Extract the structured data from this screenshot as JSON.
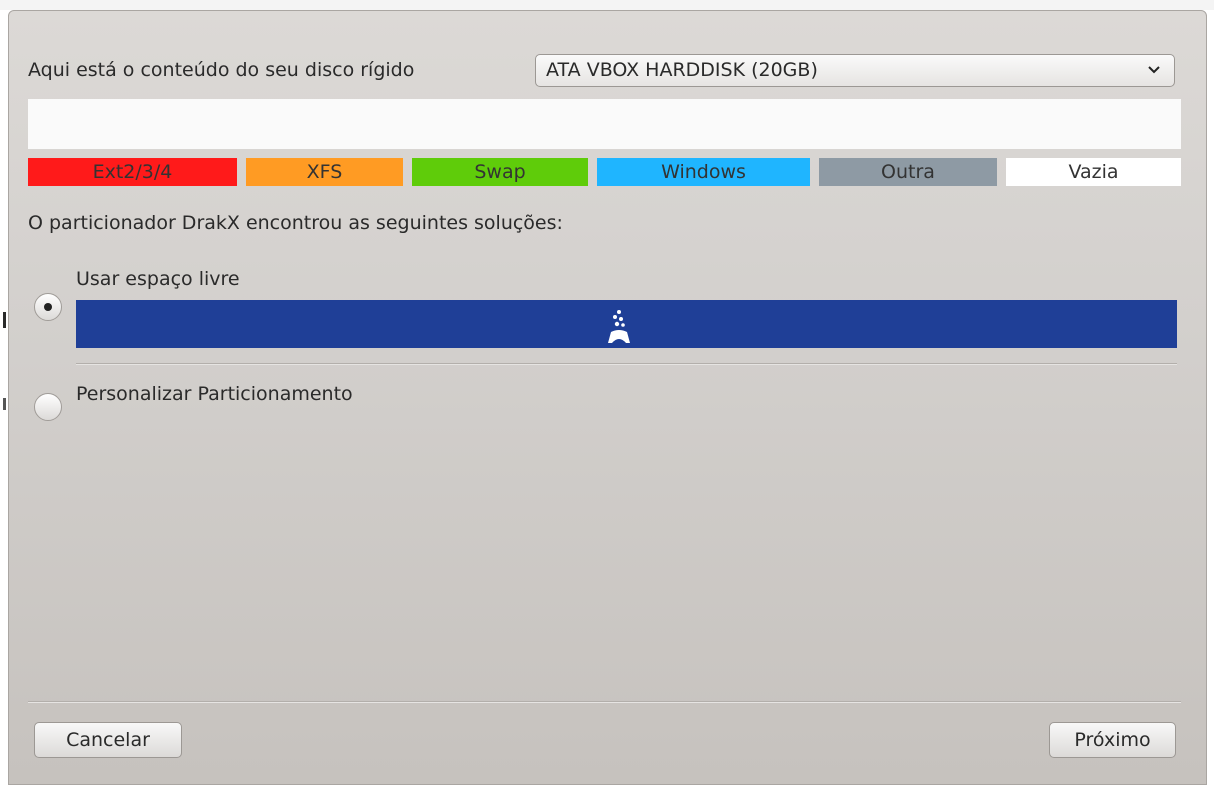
{
  "disk": {
    "label": "Aqui está o conteúdo do seu disco rígido",
    "selected": "ATA VBOX HARDDISK (20GB)"
  },
  "legend": [
    {
      "label": "Ext2/3/4",
      "color": "#ff1a1a"
    },
    {
      "label": "XFS",
      "color": "#ff9b23"
    },
    {
      "label": "Swap",
      "color": "#5fcc0a"
    },
    {
      "label": "Windows",
      "color": "#1fb5ff"
    },
    {
      "label": "Outra",
      "color": "#8e9aa4"
    },
    {
      "label": "Vazia",
      "color": "#ffffff"
    }
  ],
  "solutions": {
    "label": "O particionador DrakX encontrou as seguintes soluções:",
    "options": [
      {
        "label": "Usar espaço livre",
        "selected": true,
        "bar_color": "#1f3f97",
        "icon": "free-space-icon"
      },
      {
        "label": "Personalizar Particionamento",
        "selected": false
      }
    ]
  },
  "buttons": {
    "cancel": "Cancelar",
    "next": "Próximo"
  }
}
